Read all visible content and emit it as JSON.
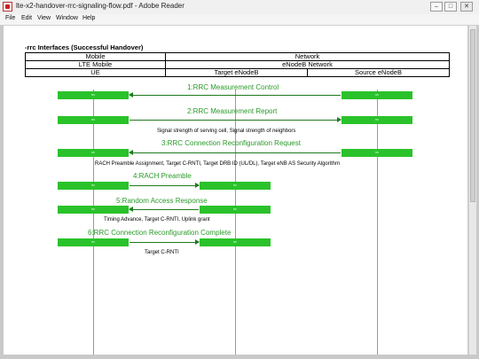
{
  "window": {
    "title": "lte-x2-handover-rrc-signaling-flow.pdf - Adobe Reader",
    "minimize": "–",
    "maximize": "□",
    "close": "✕"
  },
  "menu": [
    "File",
    "Edit",
    "View",
    "Window",
    "Help"
  ],
  "diagram": {
    "title": "-rrc Interfaces (Successful Handover)",
    "header": {
      "row1": [
        "Mobile",
        "Network"
      ],
      "row2": [
        "LTE Mobile",
        "eNodeB Network"
      ],
      "row3": [
        "UE",
        "Target eNodeB",
        "Source eNodeB"
      ]
    },
    "activation_label": "rrc",
    "messages": [
      {
        "label": "1:RRC Measurement Control",
        "note": ""
      },
      {
        "label": "2:RRC Measurement Report",
        "note": "Signal strength of serving cell, Signal strength of neighbors"
      },
      {
        "label": "3:RRC Connection Reconfiguration Request",
        "note": "RACH Preamble Assignment, Target C-RNTI, Target DRB ID (UL/DL), Target eNB AS Security Algorithm"
      },
      {
        "label": "4:RACH Preamble",
        "note": ""
      },
      {
        "label": "5:Random Access Response",
        "note": "Timing Advance, Target C-RNTI, Uplink grant"
      },
      {
        "label": "6:RRC Connection Reconfiguration Complete",
        "note": "Target C-RNTI"
      }
    ]
  }
}
